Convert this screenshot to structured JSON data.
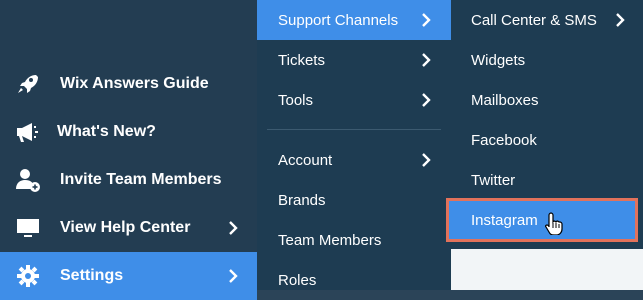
{
  "sidebar": {
    "items": [
      {
        "label": "Wix Answers Guide",
        "icon": "rocket-icon"
      },
      {
        "label": "What's New?",
        "icon": "megaphone-icon"
      },
      {
        "label": "Invite Team Members",
        "icon": "add-user-icon"
      },
      {
        "label": "View Help Center",
        "icon": "monitor-icon"
      },
      {
        "label": "Settings",
        "icon": "gear-icon"
      }
    ]
  },
  "settings_menu": {
    "items": [
      {
        "label": "Support Channels"
      },
      {
        "label": "Tickets"
      },
      {
        "label": "Tools"
      },
      {
        "label": "Account"
      },
      {
        "label": "Brands"
      },
      {
        "label": "Team Members"
      },
      {
        "label": "Roles"
      }
    ]
  },
  "support_channels_menu": {
    "items": [
      {
        "label": "Call Center & SMS"
      },
      {
        "label": "Widgets"
      },
      {
        "label": "Mailboxes"
      },
      {
        "label": "Facebook"
      },
      {
        "label": "Twitter"
      },
      {
        "label": "Instagram"
      }
    ]
  },
  "colors": {
    "sidebar_bg": "#233d52",
    "menu_bg": "#1e3c52",
    "active_blue": "#3f8ee8",
    "highlight_border": "#e2725b"
  }
}
